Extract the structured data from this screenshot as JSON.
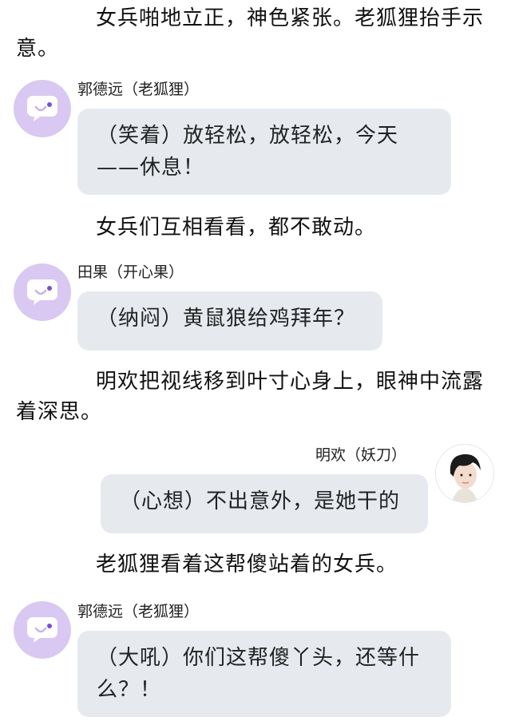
{
  "narration": [
    "女兵啪地立正，神色紧张。老狐狸抬手示意。",
    "女兵们互相看看，都不敢动。",
    "明欢把视线移到叶寸心身上，眼神中流露着深思。",
    "老狐狸看着这帮傻站着的女兵。"
  ],
  "messages": [
    {
      "name": "郭德远（老狐狸）",
      "text": "（笑着）放轻松，放轻松，今天——休息！",
      "avatar_icon": "chat-bubble-icon"
    },
    {
      "name": "田果（开心果）",
      "text": "（纳闷）黄鼠狼给鸡拜年？",
      "avatar_icon": "chat-bubble-icon"
    },
    {
      "name": "明欢（妖刀）",
      "text": "（心想）不出意外，是她干的",
      "avatar_icon": "portrait-photo"
    },
    {
      "name": "郭德远（老狐狸）",
      "text": "（大吼）你们这帮傻丫头，还等什么？！",
      "avatar_icon": "chat-bubble-icon"
    }
  ],
  "colors": {
    "avatar_bg": "#d8c8f2",
    "bubble_bg": "#e6eaef",
    "icon_dot": "#7a4fd6"
  }
}
